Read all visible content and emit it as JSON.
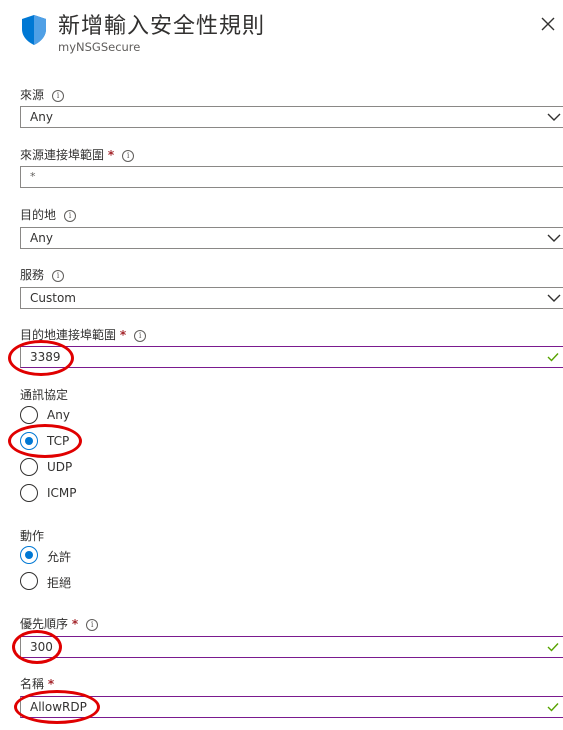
{
  "header": {
    "title": "新增輸入安全性規則",
    "subtitle": "myNSGSecure",
    "close_icon": "close-icon",
    "shield_icon": "shield-icon",
    "accent": "#0078d4"
  },
  "fields": {
    "source": {
      "label": "來源",
      "value": "Any"
    },
    "source_port": {
      "label": "來源連接埠範圍",
      "required": "*",
      "placeholder": "*"
    },
    "destination": {
      "label": "目的地",
      "value": "Any"
    },
    "service": {
      "label": "服務",
      "value": "Custom"
    },
    "dest_port": {
      "label": "目的地連接埠範圍",
      "required": "*",
      "value": "3389"
    },
    "protocol": {
      "label": "通訊協定",
      "options": [
        "Any",
        "TCP",
        "UDP",
        "ICMP"
      ],
      "selected": "TCP"
    },
    "action": {
      "label": "動作",
      "options": [
        "允許",
        "拒絕"
      ],
      "selected": "允許"
    },
    "priority": {
      "label": "優先順序",
      "required": "*",
      "value": "300"
    },
    "name": {
      "label": "名稱",
      "required": "*",
      "value": "AllowRDP"
    }
  },
  "annotation_color": "#e00000"
}
